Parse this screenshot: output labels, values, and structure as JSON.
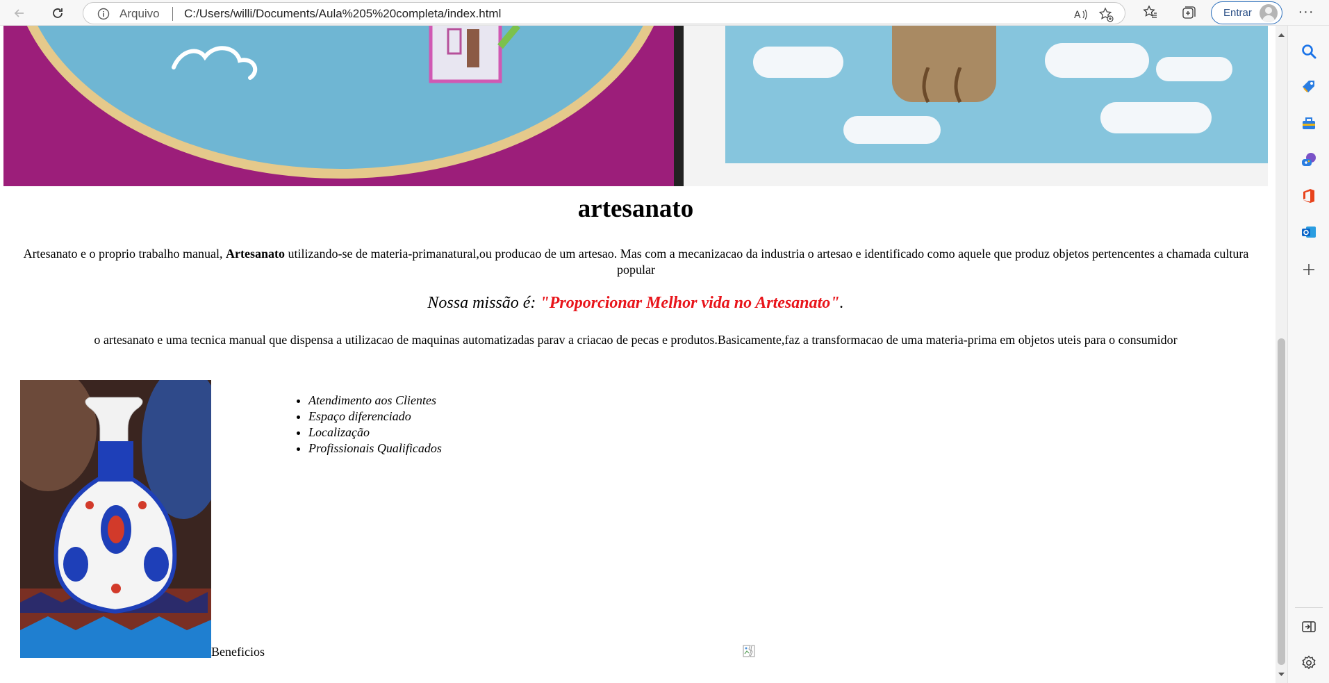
{
  "browser": {
    "address_label": "Arquivo",
    "url": "C:/Users/willi/Documents/Aula%205%20completa/index.html",
    "signin_label": "Entrar",
    "more_label": "···",
    "icons": [
      "back-icon",
      "refresh-icon",
      "info-icon",
      "read-aloud-icon",
      "add-favorite-icon",
      "favorites-icon",
      "collections-icon",
      "profile-icon",
      "more-icon"
    ]
  },
  "sidebar_icons": [
    "search-icon",
    "shopping-tag-icon",
    "tools-icon",
    "games-icon",
    "office-icon",
    "outlook-icon",
    "add-icon",
    "collapse-sidebar-icon",
    "settings-icon"
  ],
  "page": {
    "title": "artesanato",
    "intro_before": "Artesanato e o proprio trabalho manual, ",
    "intro_bold": "Artesanato",
    "intro_after": " utilizando-se de materia-primanatural,ou producao de um artesao. Mas com a mecanizacao da industria o artesao e identificado como aquele que produz objetos pertencentes a chamada cultura popular",
    "mission_prefix": "Nossa missão é: ",
    "mission_quote": "\"Proporcionar Melhor vida no Artesanato\"",
    "mission_suffix": ".",
    "description": "o artesanato e uma tecnica manual que dispensa a utilizacao de maquinas automatizadas parav a criacao de pecas e produtos.Basicamente,faz a transformacao de uma materia-prima em objetos uteis para o consumidor",
    "features": [
      "Atendimento aos Clientes",
      "Espaço diferenciado",
      "Localização",
      "Profissionais Qualificados"
    ],
    "benefits_label": "Beneficios"
  },
  "colors": {
    "mission_quote": "#e8141a",
    "accent_blue": "#2a6ebb"
  }
}
